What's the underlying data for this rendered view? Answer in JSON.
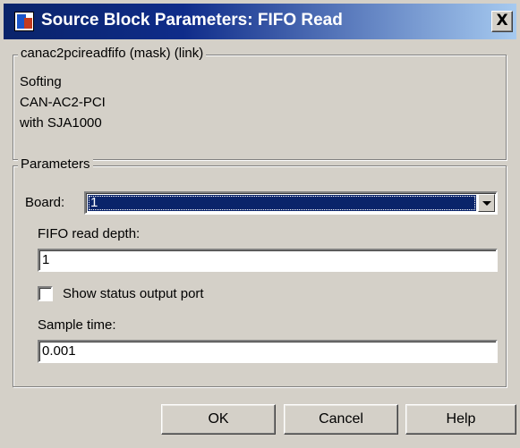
{
  "window": {
    "title": "Source Block Parameters: FIFO Read",
    "close_label": "X",
    "icon": "simulink-block-icon"
  },
  "description": {
    "legend": "canac2pcireadfifo (mask) (link)",
    "lines": [
      "Softing",
      "CAN-AC2-PCI",
      "with SJA1000"
    ]
  },
  "parameters": {
    "legend": "Parameters",
    "board": {
      "label": "Board:",
      "value": "1"
    },
    "fifo_read_depth": {
      "label": "FIFO read depth:",
      "value": "1"
    },
    "show_status": {
      "label": "Show status output port",
      "checked": false
    },
    "sample_time": {
      "label": "Sample time:",
      "value": "0.001"
    }
  },
  "buttons": {
    "ok": "OK",
    "cancel": "Cancel",
    "help": "Help"
  }
}
